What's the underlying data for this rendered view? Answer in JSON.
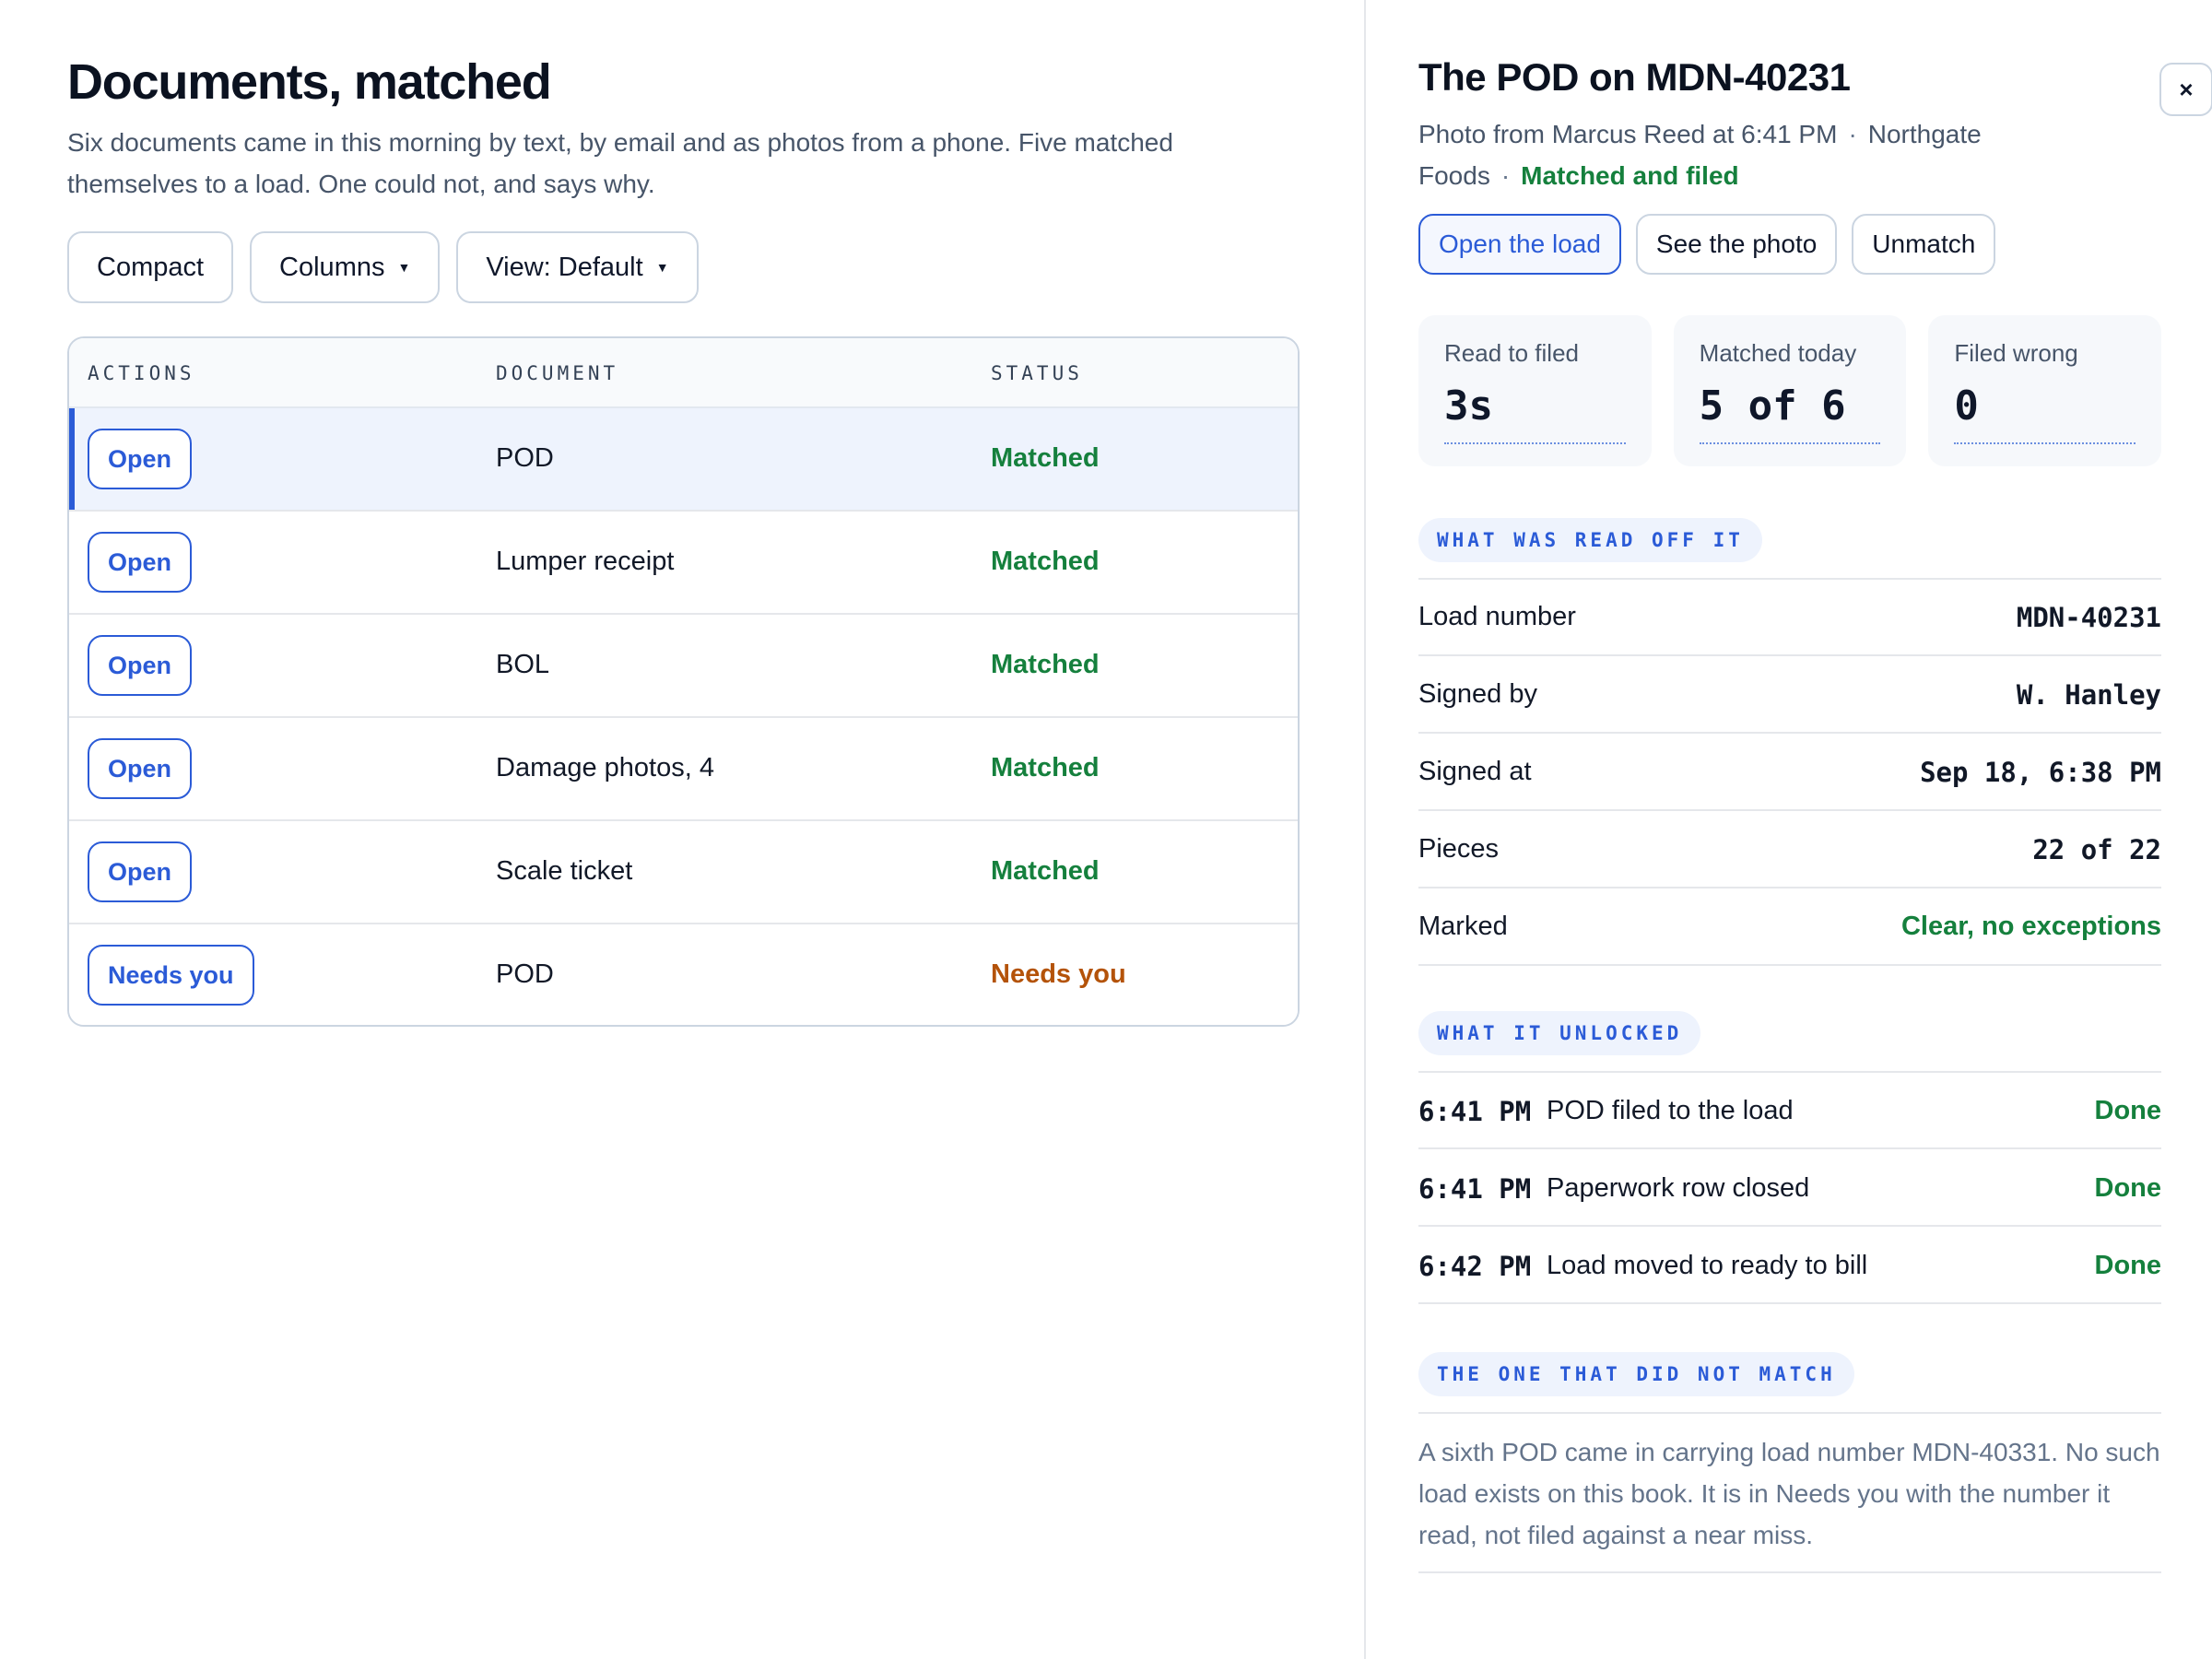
{
  "main": {
    "title": "Documents, matched",
    "subtitle": "Six documents came in this morning by text, by email and as photos from a phone. Five matched themselves to a load. One could not, and says why.",
    "toolbar": {
      "compact_label": "Compact",
      "columns_label": "Columns",
      "view_label": "View: Default"
    },
    "table": {
      "columns": [
        "ACTIONS",
        "DOCUMENT",
        "STATUS"
      ],
      "rows": [
        {
          "action": "Open",
          "document": "POD",
          "status": "Matched",
          "state": "ok",
          "selected": true
        },
        {
          "action": "Open",
          "document": "Lumper receipt",
          "status": "Matched",
          "state": "ok"
        },
        {
          "action": "Open",
          "document": "BOL",
          "status": "Matched",
          "state": "ok"
        },
        {
          "action": "Open",
          "document": "Damage photos, 4",
          "status": "Matched",
          "state": "ok"
        },
        {
          "action": "Open",
          "document": "Scale ticket",
          "status": "Matched",
          "state": "ok"
        },
        {
          "action": "Needs you",
          "document": "POD",
          "status": "Needs you",
          "state": "warn"
        }
      ]
    }
  },
  "panel": {
    "title": "The POD on MDN-40231",
    "close_icon": "close-icon",
    "close_glyph": "×",
    "meta": {
      "source": "Photo from Marcus Reed at 6:41 PM",
      "customer": "Northgate Foods",
      "status": "Matched and filed",
      "separator": "·"
    },
    "actions": {
      "open_load": "Open the load",
      "see_photo": "See the photo",
      "unmatch": "Unmatch"
    },
    "stats": [
      {
        "label": "Read to filed",
        "value": "3s"
      },
      {
        "label": "Matched today",
        "value": "5 of 6"
      },
      {
        "label": "Filed wrong",
        "value": "0"
      }
    ],
    "read_section": {
      "heading": "WHAT WAS READ OFF IT",
      "fields": [
        {
          "label": "Load number",
          "value": "MDN-40231"
        },
        {
          "label": "Signed by",
          "value": "W. Hanley"
        },
        {
          "label": "Signed at",
          "value": "Sep 18, 6:38 PM"
        },
        {
          "label": "Pieces",
          "value": "22 of 22"
        },
        {
          "label": "Marked",
          "value": "Clear, no exceptions",
          "tone": "good"
        }
      ]
    },
    "unlocked_section": {
      "heading": "WHAT IT UNLOCKED",
      "events": [
        {
          "time": "6:41 PM",
          "text": "POD filed to the load",
          "status": "Done"
        },
        {
          "time": "6:41 PM",
          "text": "Paperwork row closed",
          "status": "Done"
        },
        {
          "time": "6:42 PM",
          "text": "Load moved to ready to bill",
          "status": "Done"
        }
      ]
    },
    "mismatch_section": {
      "heading": "THE ONE THAT DID NOT MATCH",
      "text": "A sixth POD came in carrying load number MDN-40331. No such load exists on this book. It is in Needs you with the number it read, not filed against a near miss."
    }
  }
}
